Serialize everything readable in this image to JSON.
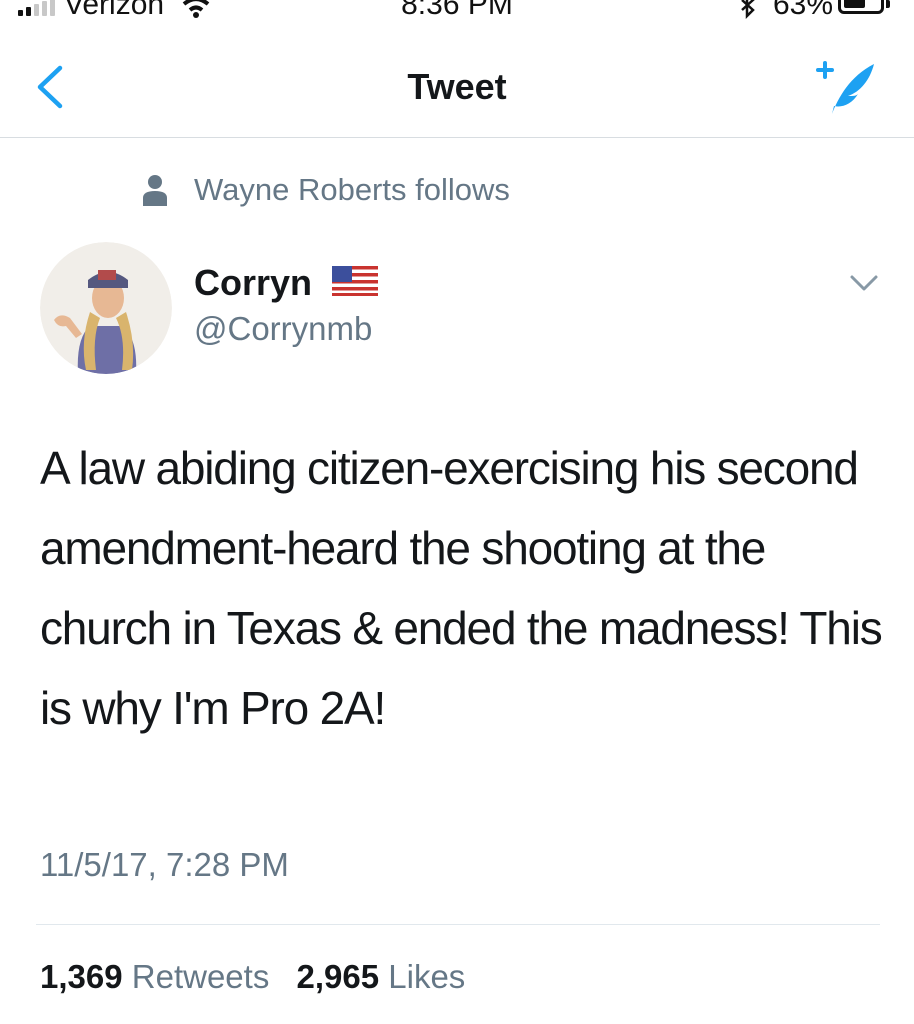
{
  "status_bar": {
    "carrier": "Verizon",
    "time": "8:36 PM",
    "battery": "63%",
    "battery_level": 0.63
  },
  "nav": {
    "title": "Tweet",
    "back_icon": "chevron-left-icon",
    "compose_icon": "compose-feather-icon",
    "accent_color": "#1da1f2"
  },
  "social_context": {
    "icon": "person-icon",
    "text": "Wayne Roberts follows"
  },
  "author": {
    "display_name": "Corryn",
    "emoji": "us-flag-icon",
    "handle": "@Corrynmb"
  },
  "tweet": {
    "text": "A law abiding citizen-exercising his second amendment-heard the shooting at the church in Texas & ended the madness! This is why I'm Pro 2A!",
    "timestamp": "11/5/17, 7:28 PM"
  },
  "stats": {
    "retweets_count": "1,369",
    "retweets_label": "Retweets",
    "likes_count": "2,965",
    "likes_label": "Likes"
  }
}
